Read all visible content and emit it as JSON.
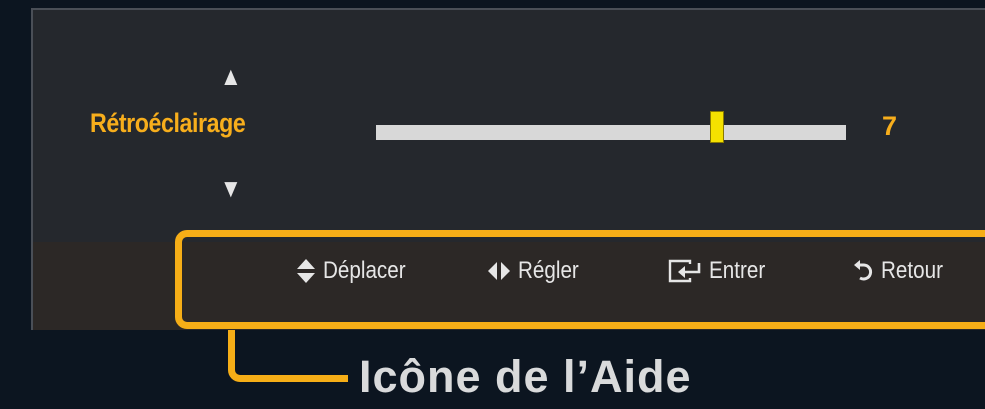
{
  "setting": {
    "label": "Rétroéclairage",
    "value": "7",
    "level_fraction": 0.725,
    "up_arrow": "▲",
    "down_arrow": "▼"
  },
  "help_bar": {
    "items": [
      {
        "icon": "updown-icon",
        "label": "Déplacer"
      },
      {
        "icon": "leftright-icon",
        "label": "Régler"
      },
      {
        "icon": "enter-icon",
        "label": "Entrer"
      },
      {
        "icon": "return-icon",
        "label": "Retour"
      }
    ]
  },
  "annotation": {
    "caption": "Icône de l’Aide"
  },
  "colors": {
    "accent": "#f7ae1c",
    "slider_thumb": "#f5e100",
    "panel_background": "#25282d",
    "page_background": "#0c1520"
  }
}
